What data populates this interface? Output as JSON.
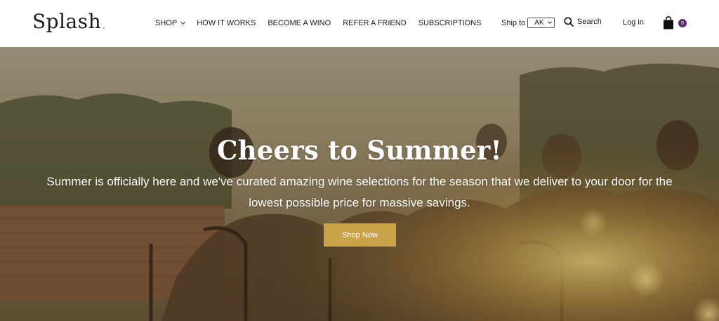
{
  "brand": {
    "logo_text": "Splash",
    "logo_tm": "™"
  },
  "nav": {
    "items": [
      {
        "label": "SHOP",
        "has_dropdown": true
      },
      {
        "label": "HOW IT WORKS"
      },
      {
        "label": "BECOME A WINO"
      },
      {
        "label": "REFER A FRIEND"
      },
      {
        "label": "SUBSCRIPTIONS"
      }
    ]
  },
  "utility": {
    "ship_label": "Ship to",
    "ship_selected": "AK",
    "search_label": "Search",
    "login_label": "Log in",
    "cart_count": "0",
    "cart_badge_color": "#5b2a6e"
  },
  "hero": {
    "title": "Cheers to Summer!",
    "subtitle": "Summer is officially here and we've curated amazing wine selections for the season that we deliver to your door for the lowest possible price for massive savings.",
    "cta_label": "Shop Now",
    "cta_color": "#c9a24a"
  }
}
